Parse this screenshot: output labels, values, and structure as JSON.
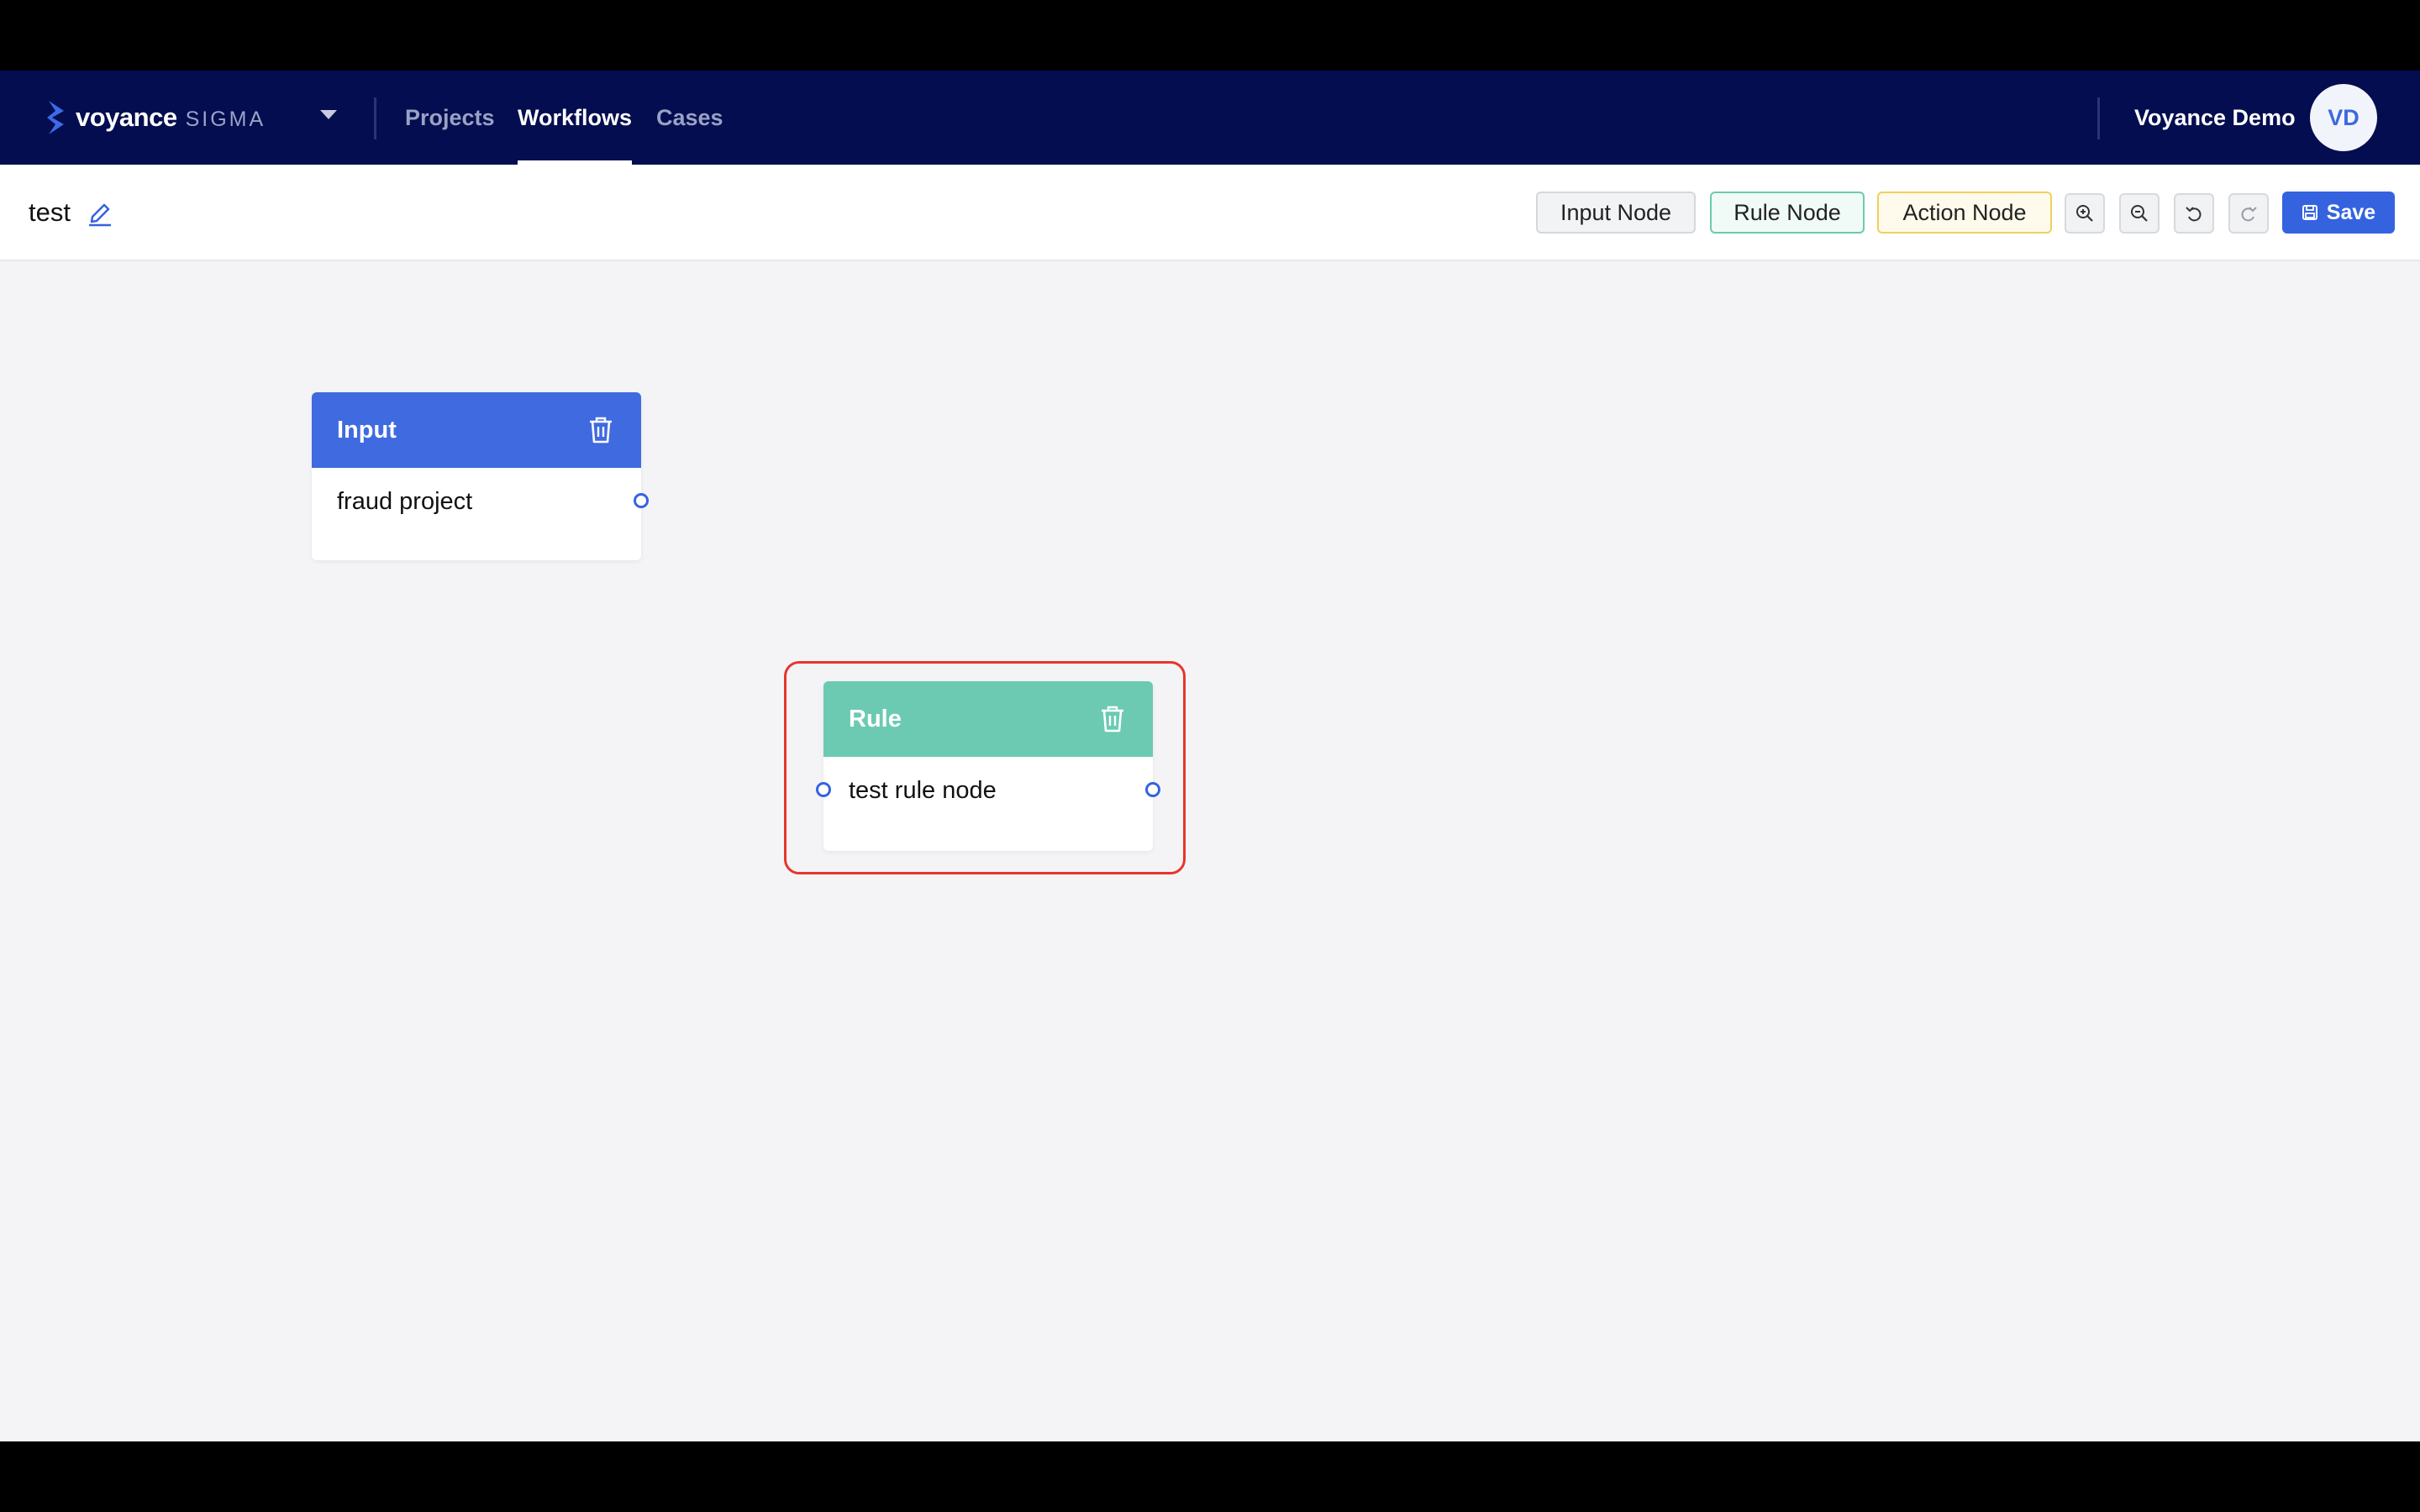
{
  "app": {
    "brand_name": "voyance",
    "brand_product": "SIGMA",
    "nav": [
      {
        "label": "Projects",
        "active": false
      },
      {
        "label": "Workflows",
        "active": true
      },
      {
        "label": "Cases",
        "active": false
      }
    ],
    "user_name": "Voyance Demo",
    "user_initials": "VD"
  },
  "toolbar": {
    "workflow_title": "test",
    "input_node_label": "Input Node",
    "rule_node_label": "Rule Node",
    "action_node_label": "Action Node",
    "save_label": "Save"
  },
  "canvas": {
    "nodes": [
      {
        "type": "input",
        "title": "Input",
        "body": "fraud project",
        "color": "#3f6ae0"
      },
      {
        "type": "rule",
        "title": "Rule",
        "body": "test rule node",
        "color": "#6ccab3",
        "selected": true
      }
    ]
  },
  "colors": {
    "navbar": "#030d4f",
    "accent": "#3563e0",
    "selection": "#e8352c"
  },
  "icons": [
    "logo-icon",
    "chevron-down-icon",
    "edit-icon",
    "zoom-in-icon",
    "zoom-out-icon",
    "undo-icon",
    "redo-icon",
    "save-icon",
    "trash-icon"
  ]
}
